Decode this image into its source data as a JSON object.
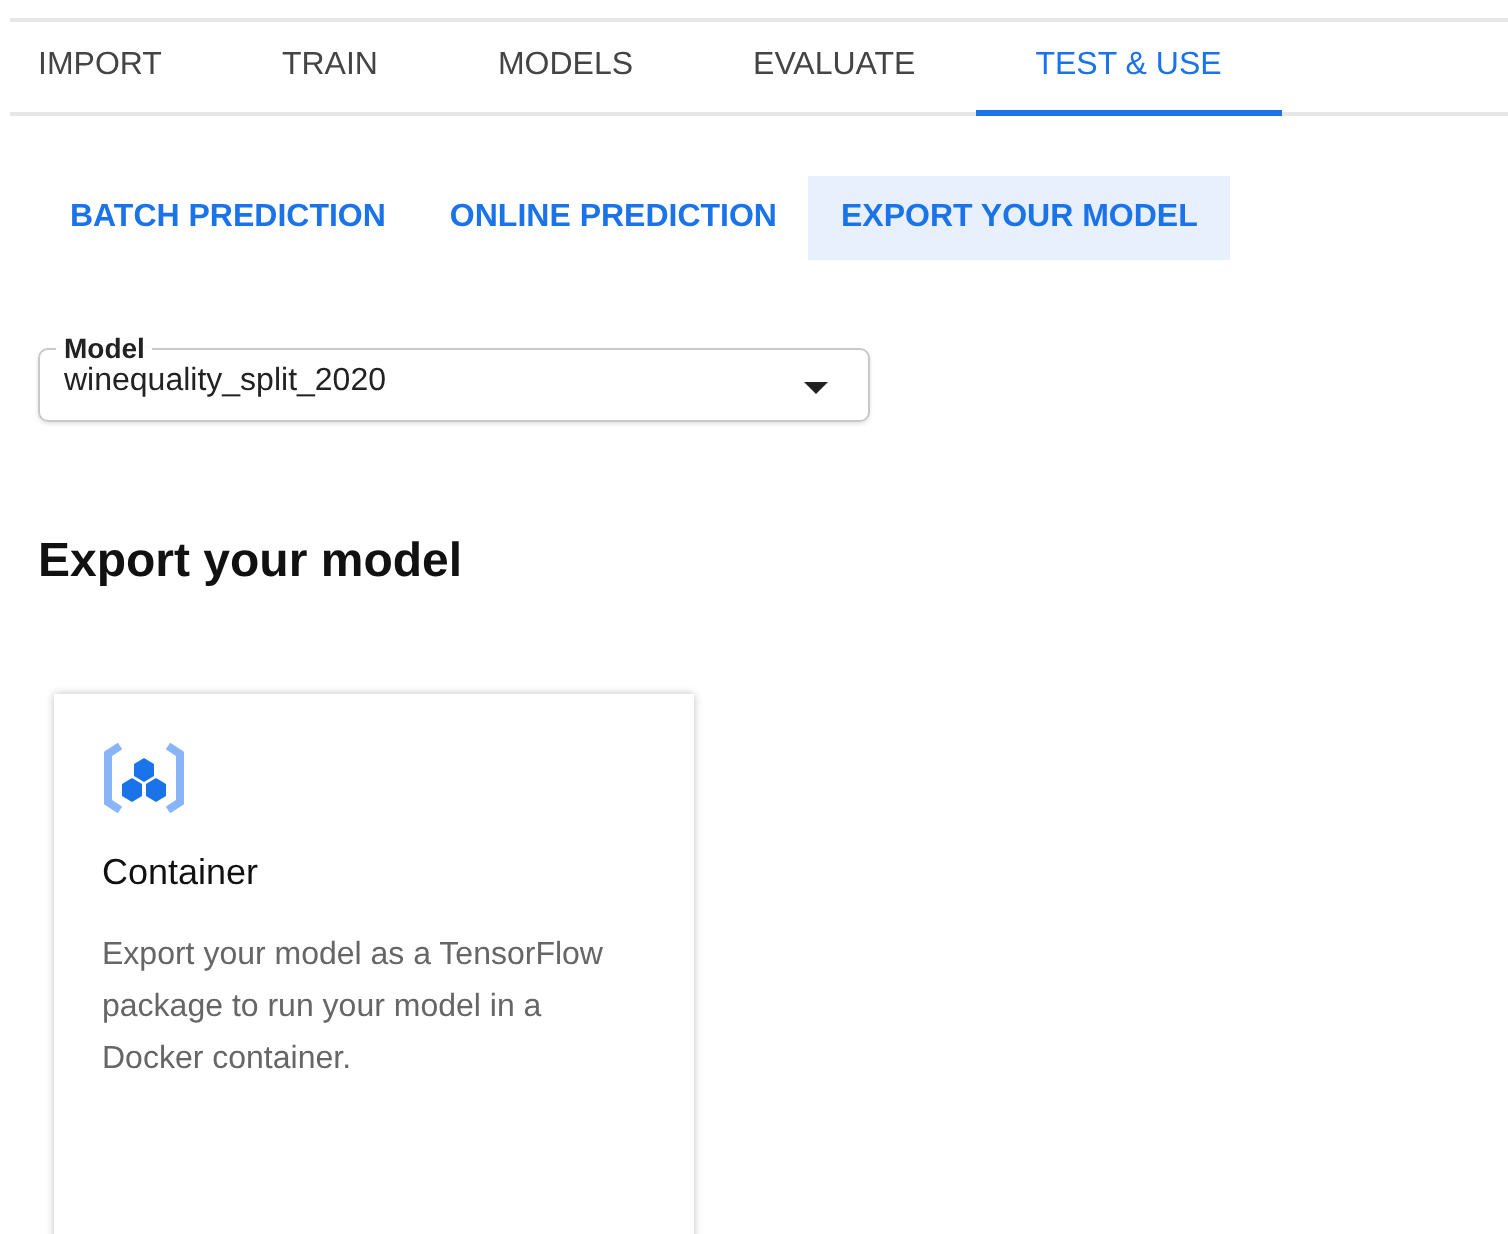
{
  "tabs": [
    {
      "label": "IMPORT",
      "selected": false
    },
    {
      "label": "TRAIN",
      "selected": false
    },
    {
      "label": "MODELS",
      "selected": false
    },
    {
      "label": "EVALUATE",
      "selected": false
    },
    {
      "label": "TEST & USE",
      "selected": true
    }
  ],
  "subtabs": [
    {
      "label": "BATCH PREDICTION",
      "selected": false
    },
    {
      "label": "ONLINE PREDICTION",
      "selected": false
    },
    {
      "label": "EXPORT YOUR MODEL",
      "selected": true
    }
  ],
  "model_select": {
    "label": "Model",
    "value": "winequality_split_2020"
  },
  "heading": "Export your model",
  "cards": [
    {
      "title": "Container",
      "description": "Export your model as a TensorFlow package to run your model in a Docker container."
    }
  ]
}
